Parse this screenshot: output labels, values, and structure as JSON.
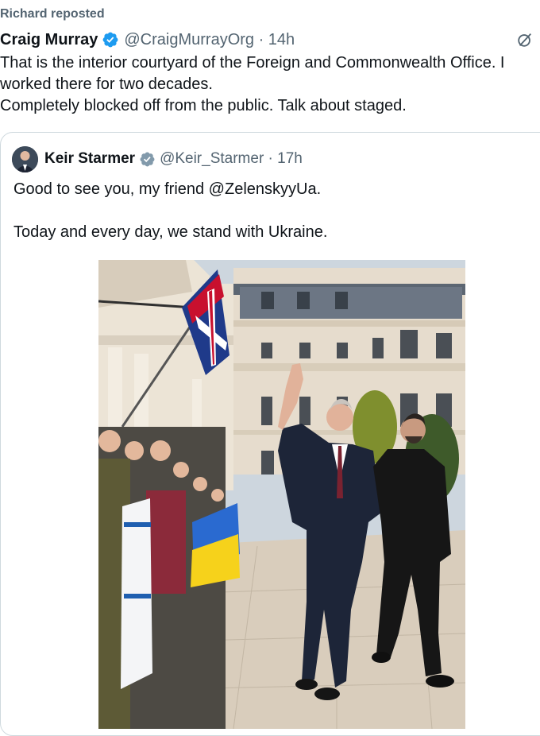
{
  "repost": {
    "label": "Richard reposted"
  },
  "tweet": {
    "author_name": "Craig Murray",
    "handle_time": "@CraigMurrayOrg · 14h",
    "text": "That is the interior courtyard of the Foreign and Commonwealth Office. I worked there for two decades.\nCompletely blocked off from the public. Talk about staged."
  },
  "quoted": {
    "author_name": "Keir Starmer",
    "handle_time": "@Keir_Starmer · 17h",
    "text": "Good to see you, my friend @ZelenskyyUa.\n\nToday and every day, we stand with Ukraine."
  },
  "icons": {
    "verified": "verified-badge-icon",
    "grok": "grok-icon"
  },
  "colors": {
    "verified_blue": "#1d9bf0",
    "verified_gray": "#829aab",
    "secondary_text": "#536471",
    "border": "#cfd9de"
  }
}
